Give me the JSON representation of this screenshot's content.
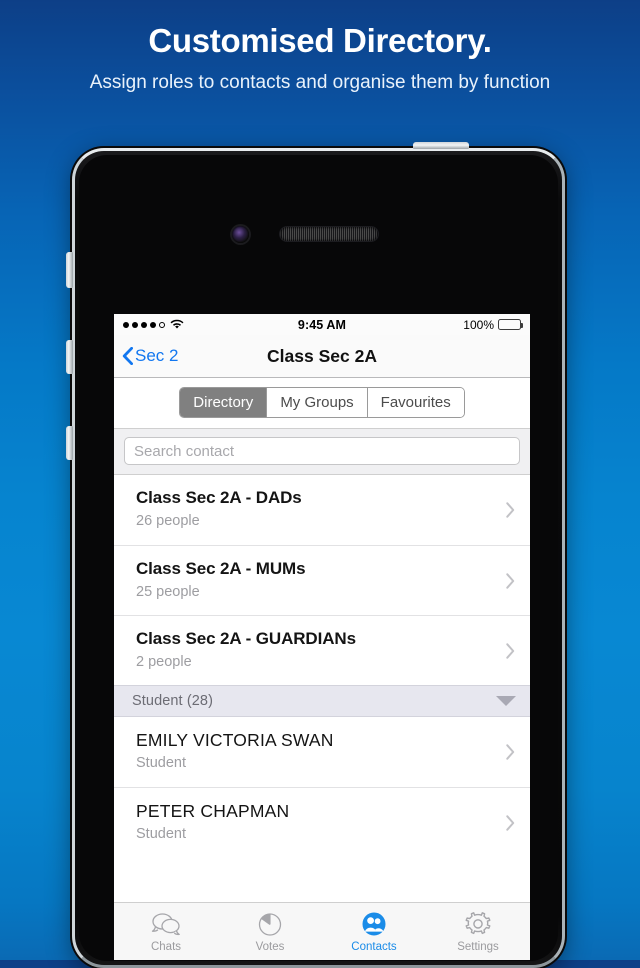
{
  "promo": {
    "title": "Customised Directory.",
    "subtitle": "Assign roles to contacts and organise them by function"
  },
  "colors": {
    "bg_top": "#0d3f87",
    "bg_mid": "#0888d3",
    "accent_blue": "#1277f0",
    "tab_active": "#1b8ce8",
    "segment_selected_bg": "#808080",
    "section_header_bg": "#e7e7ef"
  },
  "status_bar": {
    "signal_dots_total": 5,
    "signal_dots_filled": 4,
    "wifi_icon": "wifi-icon",
    "time": "9:45 AM",
    "battery_percent": "100%",
    "battery_icon": "battery-full-icon"
  },
  "nav_bar": {
    "back_label": "Sec 2",
    "back_icon": "chevron-left-icon",
    "title": "Class Sec 2A"
  },
  "segmented_control": {
    "options": [
      {
        "label": "Directory",
        "selected": true
      },
      {
        "label": "My Groups",
        "selected": false
      },
      {
        "label": "Favourites",
        "selected": false
      }
    ]
  },
  "search": {
    "value": "",
    "placeholder": "Search contact"
  },
  "groups": [
    {
      "title": "Class Sec 2A - DADs",
      "subtitle": "26 people",
      "chevron": "chevron-right-icon"
    },
    {
      "title": "Class Sec 2A - MUMs",
      "subtitle": "25 people",
      "chevron": "chevron-right-icon"
    },
    {
      "title": "Class Sec 2A - GUARDIANs",
      "subtitle": "2 people",
      "chevron": "chevron-right-icon"
    }
  ],
  "section": {
    "title": "Student (28)",
    "collapse_icon": "triangle-down-icon"
  },
  "contacts": [
    {
      "name": "EMILY VICTORIA SWAN",
      "role": "Student",
      "chevron": "chevron-right-icon"
    },
    {
      "name": "PETER CHAPMAN",
      "role": "Student",
      "chevron": "chevron-right-icon"
    }
  ],
  "tab_bar": {
    "tabs": [
      {
        "label": "Chats",
        "icon": "chat-bubbles-icon",
        "active": false
      },
      {
        "label": "Votes",
        "icon": "pie-chart-icon",
        "active": false
      },
      {
        "label": "Contacts",
        "icon": "contacts-people-icon",
        "active": true
      },
      {
        "label": "Settings",
        "icon": "gear-icon",
        "active": false
      }
    ]
  }
}
